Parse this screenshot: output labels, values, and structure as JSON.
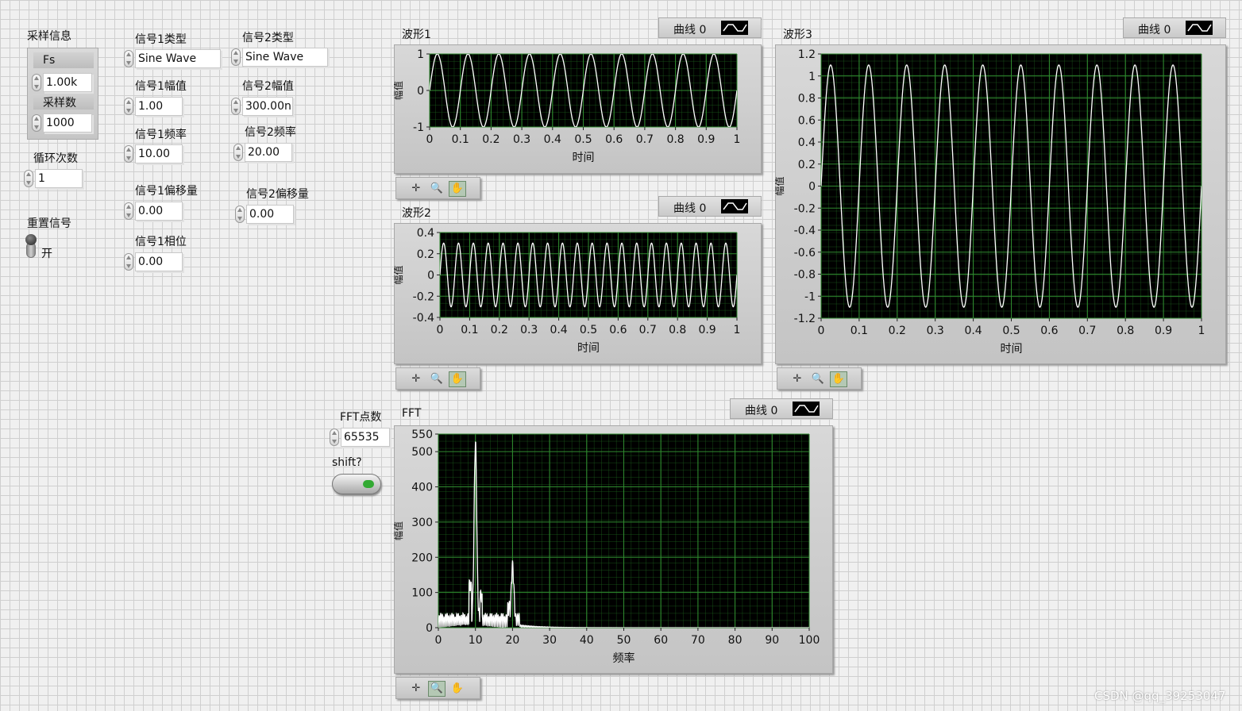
{
  "controls": {
    "sampling_title": "采样信息",
    "fs_label": "Fs",
    "fs_value": "1.00k",
    "samples_label": "采样数",
    "samples_value": "1000",
    "loops_label": "循环次数",
    "loops_value": "1",
    "reset_label": "重置信号",
    "reset_state": "开",
    "sig1": {
      "type_label": "信号1类型",
      "type_value": "Sine Wave",
      "amp_label": "信号1幅值",
      "amp_value": "1.00",
      "freq_label": "信号1频率",
      "freq_value": "10.00",
      "offset_label": "信号1偏移量",
      "offset_value": "0.00",
      "phase_label": "信号1相位",
      "phase_value": "0.00"
    },
    "sig2": {
      "type_label": "信号2类型",
      "type_value": "Sine Wave",
      "amp_label": "信号2幅值",
      "amp_value": "300.00n",
      "freq_label": "信号2频率",
      "freq_value": "20.00",
      "offset_label": "信号2偏移量",
      "offset_value": "0.00"
    },
    "fft_points_label": "FFT点数",
    "fft_points_value": "65535",
    "shift_label": "shift?"
  },
  "legend_text": "曲线 0",
  "watermark": "CSDN @qq_39253047",
  "palette_icons": [
    "cursor-move-icon",
    "zoom-icon",
    "pan-hand-icon"
  ],
  "colors": {
    "plot_bg": "#000000",
    "grid": "#1f6b1f",
    "trace": "#ffffff",
    "led": "#33aa33"
  },
  "chart_data": [
    {
      "id": "wave1",
      "type": "line",
      "title": "波形1",
      "xlabel": "时间",
      "ylabel": "幅值",
      "xlim": [
        0,
        1
      ],
      "ylim": [
        -1,
        1
      ],
      "xticks": [
        "0",
        "0.1",
        "0.2",
        "0.3",
        "0.4",
        "0.5",
        "0.6",
        "0.7",
        "0.8",
        "0.9",
        "1"
      ],
      "yticks": [
        "1",
        "0",
        "-1"
      ],
      "series": [
        {
          "name": "曲线 0",
          "waveform": "sine",
          "amplitude": 1,
          "frequency": 10,
          "offset": 0
        }
      ]
    },
    {
      "id": "wave2",
      "type": "line",
      "title": "波形2",
      "xlabel": "时间",
      "ylabel": "幅值",
      "xlim": [
        0,
        1
      ],
      "ylim": [
        -0.4,
        0.4
      ],
      "xticks": [
        "0",
        "0.1",
        "0.2",
        "0.3",
        "0.4",
        "0.5",
        "0.6",
        "0.7",
        "0.8",
        "0.9",
        "1"
      ],
      "yticks": [
        "0.4",
        "0.2",
        "0",
        "-0.2",
        "-0.4"
      ],
      "series": [
        {
          "name": "曲线 0",
          "waveform": "sine",
          "amplitude": 0.3,
          "frequency": 20,
          "offset": 0
        }
      ]
    },
    {
      "id": "wave3",
      "type": "line",
      "title": "波形3",
      "xlabel": "时间",
      "ylabel": "幅值",
      "xlim": [
        0,
        1
      ],
      "ylim": [
        -1.2,
        1.2
      ],
      "xticks": [
        "0",
        "0.1",
        "0.2",
        "0.3",
        "0.4",
        "0.5",
        "0.6",
        "0.7",
        "0.8",
        "0.9",
        "1"
      ],
      "yticks": [
        "1.2",
        "1",
        "0.8",
        "0.6",
        "0.4",
        "0.2",
        "0",
        "-0.2",
        "-0.4",
        "-0.6",
        "-0.8",
        "-1",
        "-1.2"
      ],
      "series": [
        {
          "name": "曲线 0",
          "waveform": "sine",
          "amplitude": 1.1,
          "frequency": 10,
          "offset": 0
        }
      ]
    },
    {
      "id": "fft",
      "type": "line",
      "title": "FFT",
      "xlabel": "频率",
      "ylabel": "幅值",
      "xlim": [
        0,
        100
      ],
      "ylim": [
        0,
        550
      ],
      "xticks": [
        "0",
        "10",
        "20",
        "30",
        "40",
        "50",
        "60",
        "70",
        "80",
        "90",
        "100"
      ],
      "yticks": [
        "550",
        "500",
        "400",
        "300",
        "200",
        "100",
        "0"
      ],
      "series": [
        {
          "name": "曲线 0",
          "peaks": [
            {
              "x": 10,
              "y": 500
            },
            {
              "x": 20,
              "y": 150
            }
          ]
        }
      ]
    }
  ]
}
